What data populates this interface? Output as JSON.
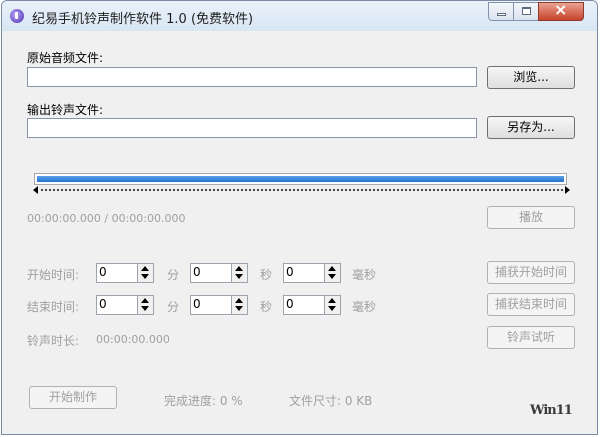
{
  "window": {
    "title": "纪易手机铃声制作软件 1.0 (免费软件)",
    "icon": "music-note-icon"
  },
  "source": {
    "label": "原始音频文件:",
    "value": "",
    "browse_label": "浏览..."
  },
  "output": {
    "label": "输出铃声文件:",
    "value": "",
    "save_as_label": "另存为..."
  },
  "playback": {
    "time_readout": "00:00:00.000 / 00:00:00.000",
    "play_label": "播放"
  },
  "start_time": {
    "label": "开始时间:",
    "minutes": "0",
    "seconds": "0",
    "milliseconds": "0",
    "capture_label": "捕获开始时间"
  },
  "end_time": {
    "label": "结束时间:",
    "minutes": "0",
    "seconds": "0",
    "milliseconds": "0",
    "capture_label": "捕获结束时间"
  },
  "units": {
    "minute": "分",
    "second": "秒",
    "millisecond": "毫秒"
  },
  "duration": {
    "label": "铃声时长:",
    "value": "00:00:00.000",
    "preview_label": "铃声试听"
  },
  "footer": {
    "start_button_label": "开始制作",
    "progress_label": "完成进度: 0 %",
    "size_label": "文件尺寸: 0 KB"
  },
  "watermark": "Win11"
}
